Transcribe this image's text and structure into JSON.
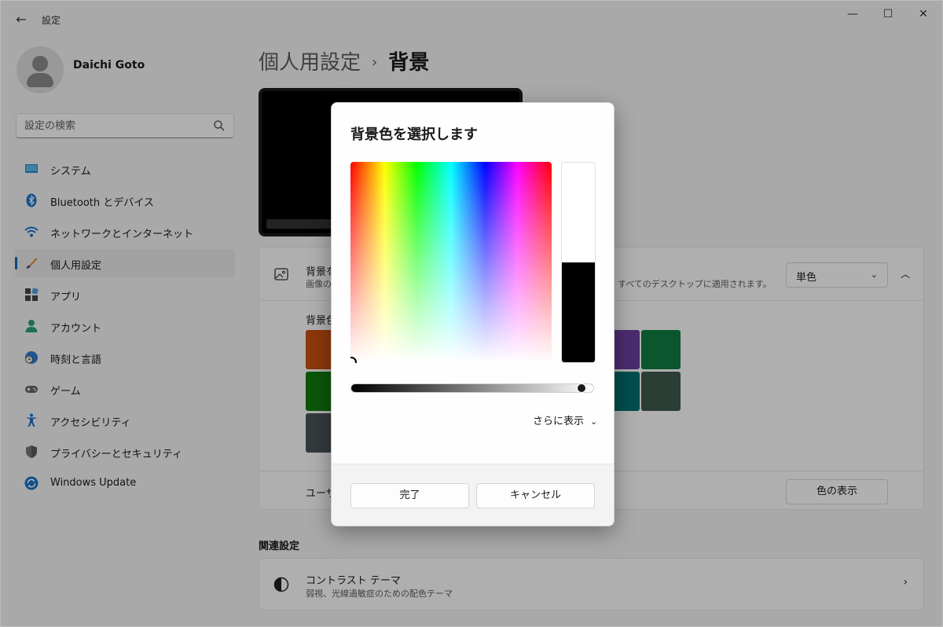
{
  "window": {
    "title": "設定",
    "back_glyph": "←",
    "minimize_glyph": "—",
    "maximize_glyph": "☐",
    "close_glyph": "✕"
  },
  "profile": {
    "name": "Daichi Goto"
  },
  "search": {
    "placeholder": "設定の検索"
  },
  "sidebar": {
    "items": [
      {
        "label": "システム",
        "icon": "monitor-icon"
      },
      {
        "label": "Bluetooth とデバイス",
        "icon": "bluetooth-icon"
      },
      {
        "label": "ネットワークとインターネット",
        "icon": "wifi-icon"
      },
      {
        "label": "個人用設定",
        "icon": "brush-icon",
        "active": true
      },
      {
        "label": "アプリ",
        "icon": "apps-icon"
      },
      {
        "label": "アカウント",
        "icon": "person-icon"
      },
      {
        "label": "時刻と言語",
        "icon": "globe-clock-icon"
      },
      {
        "label": "ゲーム",
        "icon": "gamepad-icon"
      },
      {
        "label": "アクセシビリティ",
        "icon": "accessibility-icon"
      },
      {
        "label": "プライバシーとセキュリティ",
        "icon": "shield-icon"
      },
      {
        "label": "Windows Update",
        "icon": "update-icon"
      }
    ]
  },
  "main": {
    "breadcrumb_parent": "個人用設定",
    "breadcrumb_sep": "›",
    "breadcrumb_current": "背景",
    "background": {
      "title_visible": "背景を",
      "desc_visible": "画像の",
      "desc_right": "すべてのデスクトップに適用されます。",
      "dropdown_value": "単色",
      "dropdown_chev": "⌄",
      "collapse_chev": "︿",
      "swatch_title_visible": "背景色",
      "swatches": [
        {
          "color": "#ca5010"
        },
        {
          "color": "#107c10"
        },
        {
          "color": "#4a5459"
        },
        {
          "color": "#6b3fa0"
        },
        {
          "color": "#107c41"
        },
        {
          "color": "#007070"
        },
        {
          "color": "#3e5a4e"
        }
      ],
      "user_row_visible": "ユーザ",
      "show_color_button": "色の表示"
    },
    "related_title": "関連設定",
    "contrast": {
      "title": "コントラスト テーマ",
      "desc": "弱視、光線過敏症のための配色テーマ",
      "chev": "›"
    }
  },
  "dialog": {
    "title": "背景色を選択します",
    "preview_top_color": "#ffffff",
    "preview_bottom_color": "#000000",
    "value_slider_level": 0.97,
    "more_label": "さらに表示",
    "more_chev": "⌄",
    "done_button": "完了",
    "cancel_button": "キャンセル"
  }
}
